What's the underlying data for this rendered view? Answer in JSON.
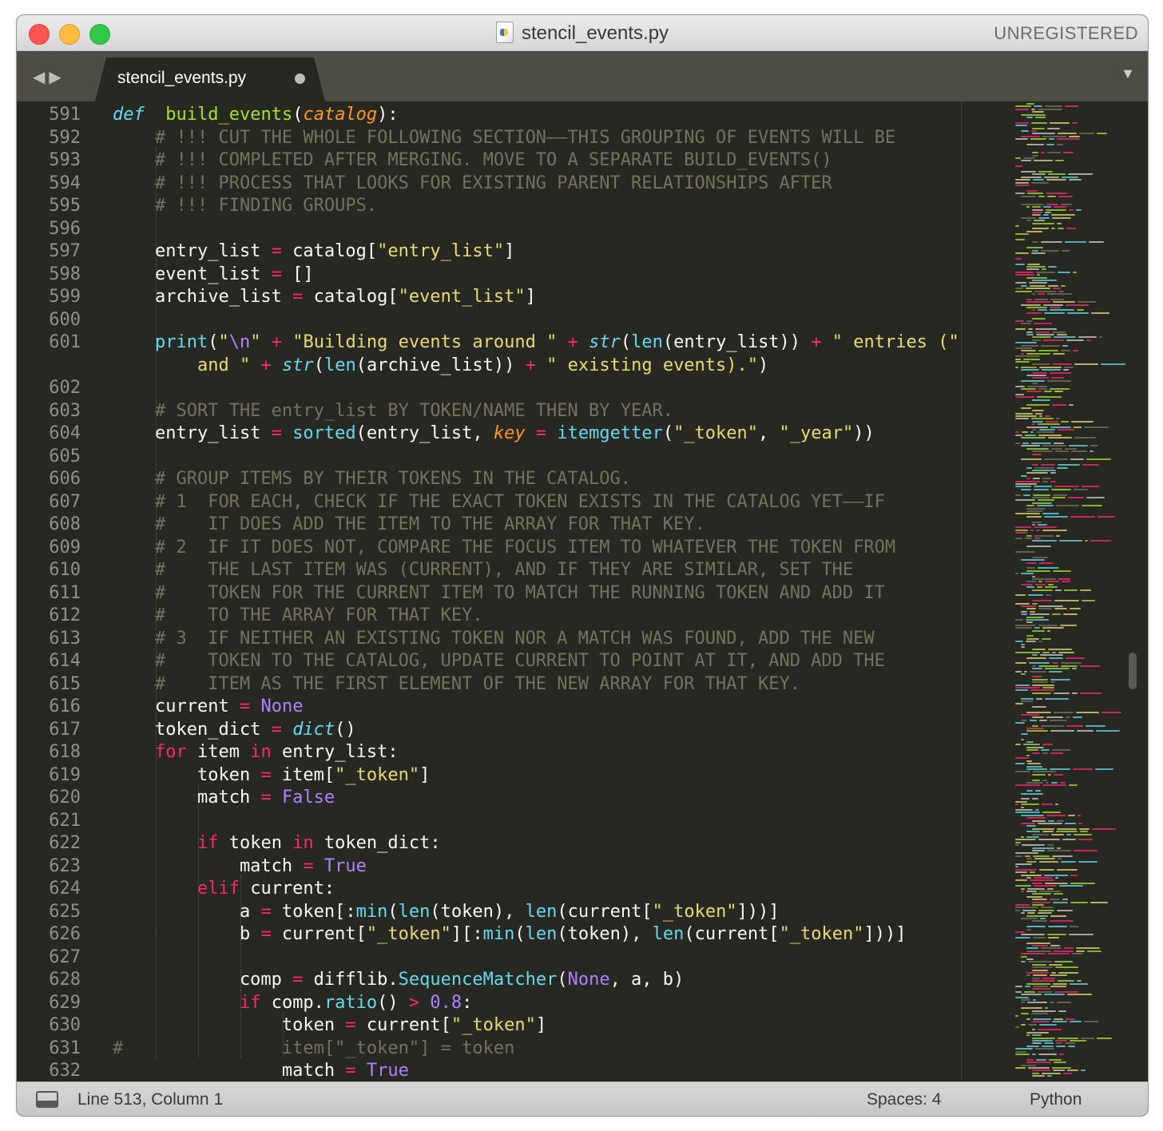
{
  "window": {
    "title": "stencil_events.py",
    "registration_label": "UNREGISTERED"
  },
  "tabbar": {
    "active_tab": "stencil_events.py"
  },
  "editor": {
    "lines": [
      {
        "no": "591",
        "tokens": [
          [
            "df",
            "def"
          ],
          [
            "",
            "  "
          ],
          [
            "fn",
            "build_events"
          ],
          [
            "",
            "("
          ],
          [
            "pr",
            "catalog"
          ],
          [
            "",
            "):"
          ]
        ]
      },
      {
        "no": "592",
        "tokens": [
          [
            "",
            "    "
          ],
          [
            "cm",
            "# !!! CUT THE WHOLE FOLLOWING SECTION——THIS GROUPING OF EVENTS WILL BE"
          ]
        ]
      },
      {
        "no": "593",
        "tokens": [
          [
            "",
            "    "
          ],
          [
            "cm",
            "# !!! COMPLETED AFTER MERGING. MOVE TO A SEPARATE BUILD_EVENTS()"
          ]
        ]
      },
      {
        "no": "594",
        "tokens": [
          [
            "",
            "    "
          ],
          [
            "cm",
            "# !!! PROCESS THAT LOOKS FOR EXISTING PARENT RELATIONSHIPS AFTER"
          ]
        ]
      },
      {
        "no": "595",
        "tokens": [
          [
            "",
            "    "
          ],
          [
            "cm",
            "# !!! FINDING GROUPS."
          ]
        ]
      },
      {
        "no": "596",
        "tokens": []
      },
      {
        "no": "597",
        "tokens": [
          [
            "",
            "    entry_list "
          ],
          [
            "kw",
            "="
          ],
          [
            "",
            " catalog["
          ],
          [
            "st",
            "\"entry_list\""
          ],
          [
            "",
            "]"
          ]
        ]
      },
      {
        "no": "598",
        "tokens": [
          [
            "",
            "    event_list "
          ],
          [
            "kw",
            "="
          ],
          [
            "",
            " []"
          ]
        ]
      },
      {
        "no": "599",
        "tokens": [
          [
            "",
            "    archive_list "
          ],
          [
            "kw",
            "="
          ],
          [
            "",
            " catalog["
          ],
          [
            "st",
            "\"event_list\""
          ],
          [
            "",
            "]"
          ]
        ]
      },
      {
        "no": "600",
        "tokens": []
      },
      {
        "no": "601",
        "tokens": [
          [
            "",
            "    "
          ],
          [
            "bi",
            "print"
          ],
          [
            "",
            "("
          ],
          [
            "st",
            "\""
          ],
          [
            "nu",
            "\\n"
          ],
          [
            "st",
            "\""
          ],
          [
            "",
            " "
          ],
          [
            "kw",
            "+"
          ],
          [
            "",
            " "
          ],
          [
            "st",
            "\"Building events around \""
          ],
          [
            "",
            " "
          ],
          [
            "kw",
            "+"
          ],
          [
            "",
            " "
          ],
          [
            "it",
            "str"
          ],
          [
            "",
            "("
          ],
          [
            "bi",
            "len"
          ],
          [
            "",
            "(entry_list)) "
          ],
          [
            "kw",
            "+"
          ],
          [
            "",
            " "
          ],
          [
            "st",
            "\" entries (\""
          ]
        ]
      },
      {
        "no": "",
        "tokens": [
          [
            "",
            "        "
          ],
          [
            "st",
            "and \""
          ],
          [
            "",
            " "
          ],
          [
            "kw",
            "+"
          ],
          [
            "",
            " "
          ],
          [
            "it",
            "str"
          ],
          [
            "",
            "("
          ],
          [
            "bi",
            "len"
          ],
          [
            "",
            "(archive_list)) "
          ],
          [
            "kw",
            "+"
          ],
          [
            "",
            " "
          ],
          [
            "st",
            "\" existing events).\""
          ],
          [
            "",
            ")"
          ]
        ]
      },
      {
        "no": "602",
        "tokens": []
      },
      {
        "no": "603",
        "tokens": [
          [
            "",
            "    "
          ],
          [
            "cm",
            "# SORT THE entry_list BY TOKEN/NAME THEN BY YEAR."
          ]
        ]
      },
      {
        "no": "604",
        "tokens": [
          [
            "",
            "    entry_list "
          ],
          [
            "kw",
            "="
          ],
          [
            "",
            " "
          ],
          [
            "bi",
            "sorted"
          ],
          [
            "",
            "(entry_list, "
          ],
          [
            "pr",
            "key"
          ],
          [
            "",
            " "
          ],
          [
            "kw",
            "="
          ],
          [
            "",
            " "
          ],
          [
            "bi",
            "itemgetter"
          ],
          [
            "",
            "("
          ],
          [
            "st",
            "\"_token\""
          ],
          [
            "",
            ", "
          ],
          [
            "st",
            "\"_year\""
          ],
          [
            "",
            "))"
          ]
        ]
      },
      {
        "no": "605",
        "tokens": []
      },
      {
        "no": "606",
        "tokens": [
          [
            "",
            "    "
          ],
          [
            "cm",
            "# GROUP ITEMS BY THEIR TOKENS IN THE CATALOG."
          ]
        ]
      },
      {
        "no": "607",
        "tokens": [
          [
            "",
            "    "
          ],
          [
            "cm",
            "# 1  FOR EACH, CHECK IF THE EXACT TOKEN EXISTS IN THE CATALOG YET——IF"
          ]
        ]
      },
      {
        "no": "608",
        "tokens": [
          [
            "",
            "    "
          ],
          [
            "cm",
            "#    IT DOES ADD THE ITEM TO THE ARRAY FOR THAT KEY."
          ]
        ]
      },
      {
        "no": "609",
        "tokens": [
          [
            "",
            "    "
          ],
          [
            "cm",
            "# 2  IF IT DOES NOT, COMPARE THE FOCUS ITEM TO WHATEVER THE TOKEN FROM"
          ]
        ]
      },
      {
        "no": "610",
        "tokens": [
          [
            "",
            "    "
          ],
          [
            "cm",
            "#    THE LAST ITEM WAS (CURRENT), AND IF THEY ARE SIMILAR, SET THE"
          ]
        ]
      },
      {
        "no": "611",
        "tokens": [
          [
            "",
            "    "
          ],
          [
            "cm",
            "#    TOKEN FOR THE CURRENT ITEM TO MATCH THE RUNNING TOKEN AND ADD IT"
          ]
        ]
      },
      {
        "no": "612",
        "tokens": [
          [
            "",
            "    "
          ],
          [
            "cm",
            "#    TO THE ARRAY FOR THAT KEY."
          ]
        ]
      },
      {
        "no": "613",
        "tokens": [
          [
            "",
            "    "
          ],
          [
            "cm",
            "# 3  IF NEITHER AN EXISTING TOKEN NOR A MATCH WAS FOUND, ADD THE NEW"
          ]
        ]
      },
      {
        "no": "614",
        "tokens": [
          [
            "",
            "    "
          ],
          [
            "cm",
            "#    TOKEN TO THE CATALOG, UPDATE CURRENT TO POINT AT IT, AND ADD THE"
          ]
        ]
      },
      {
        "no": "615",
        "tokens": [
          [
            "",
            "    "
          ],
          [
            "cm",
            "#    ITEM AS THE FIRST ELEMENT OF THE NEW ARRAY FOR THAT KEY."
          ]
        ]
      },
      {
        "no": "616",
        "tokens": [
          [
            "",
            "    current "
          ],
          [
            "kw",
            "="
          ],
          [
            "",
            " "
          ],
          [
            "nu",
            "None"
          ]
        ]
      },
      {
        "no": "617",
        "tokens": [
          [
            "",
            "    token_dict "
          ],
          [
            "kw",
            "="
          ],
          [
            "",
            " "
          ],
          [
            "it",
            "dict"
          ],
          [
            "",
            "()"
          ]
        ]
      },
      {
        "no": "618",
        "tokens": [
          [
            "",
            "    "
          ],
          [
            "kw",
            "for"
          ],
          [
            "",
            " item "
          ],
          [
            "kw",
            "in"
          ],
          [
            "",
            " entry_list:"
          ]
        ]
      },
      {
        "no": "619",
        "tokens": [
          [
            "",
            "        token "
          ],
          [
            "kw",
            "="
          ],
          [
            "",
            " item["
          ],
          [
            "st",
            "\"_token\""
          ],
          [
            "",
            "]"
          ]
        ]
      },
      {
        "no": "620",
        "tokens": [
          [
            "",
            "        match "
          ],
          [
            "kw",
            "="
          ],
          [
            "",
            " "
          ],
          [
            "nu",
            "False"
          ]
        ]
      },
      {
        "no": "621",
        "tokens": []
      },
      {
        "no": "622",
        "tokens": [
          [
            "",
            "        "
          ],
          [
            "kw",
            "if"
          ],
          [
            "",
            " token "
          ],
          [
            "kw",
            "in"
          ],
          [
            "",
            " token_dict:"
          ]
        ]
      },
      {
        "no": "623",
        "tokens": [
          [
            "",
            "            match "
          ],
          [
            "kw",
            "="
          ],
          [
            "",
            " "
          ],
          [
            "nu",
            "True"
          ]
        ]
      },
      {
        "no": "624",
        "tokens": [
          [
            "",
            "        "
          ],
          [
            "kw",
            "elif"
          ],
          [
            "",
            " current:"
          ]
        ]
      },
      {
        "no": "625",
        "tokens": [
          [
            "",
            "            a "
          ],
          [
            "kw",
            "="
          ],
          [
            "",
            " token[:"
          ],
          [
            "bi",
            "min"
          ],
          [
            "",
            "("
          ],
          [
            "bi",
            "len"
          ],
          [
            "",
            "(token), "
          ],
          [
            "bi",
            "len"
          ],
          [
            "",
            "(current["
          ],
          [
            "st",
            "\"_token\""
          ],
          [
            "",
            "]))]"
          ]
        ]
      },
      {
        "no": "626",
        "tokens": [
          [
            "",
            "            b "
          ],
          [
            "kw",
            "="
          ],
          [
            "",
            " current["
          ],
          [
            "st",
            "\"_token\""
          ],
          [
            "",
            "][:"
          ],
          [
            "bi",
            "min"
          ],
          [
            "",
            "("
          ],
          [
            "bi",
            "len"
          ],
          [
            "",
            "(token), "
          ],
          [
            "bi",
            "len"
          ],
          [
            "",
            "(current["
          ],
          [
            "st",
            "\"_token\""
          ],
          [
            "",
            "]))]"
          ]
        ]
      },
      {
        "no": "627",
        "tokens": []
      },
      {
        "no": "628",
        "tokens": [
          [
            "",
            "            comp "
          ],
          [
            "kw",
            "="
          ],
          [
            "",
            " difflib."
          ],
          [
            "bi",
            "SequenceMatcher"
          ],
          [
            "",
            "("
          ],
          [
            "nu",
            "None"
          ],
          [
            "",
            ", a, b)"
          ]
        ]
      },
      {
        "no": "629",
        "tokens": [
          [
            "",
            "            "
          ],
          [
            "kw",
            "if"
          ],
          [
            "",
            " comp."
          ],
          [
            "bi",
            "ratio"
          ],
          [
            "",
            "() "
          ],
          [
            "kw",
            ">"
          ],
          [
            "",
            " "
          ],
          [
            "nu",
            "0.8"
          ],
          [
            "",
            ":"
          ]
        ]
      },
      {
        "no": "630",
        "tokens": [
          [
            "",
            "                token "
          ],
          [
            "kw",
            "="
          ],
          [
            "",
            " current["
          ],
          [
            "st",
            "\"_token\""
          ],
          [
            "",
            "]"
          ]
        ]
      },
      {
        "no": "631",
        "tokens": [
          [
            "cm",
            "#               item[\"_token\"] = token"
          ]
        ]
      },
      {
        "no": "632",
        "tokens": [
          [
            "",
            "                match "
          ],
          [
            "kw",
            "="
          ],
          [
            "",
            " "
          ],
          [
            "nu",
            "True"
          ]
        ]
      }
    ]
  },
  "statusbar": {
    "position": "Line 513, Column 1",
    "indentation": "Spaces: 4",
    "syntax": "Python"
  },
  "icons": {
    "file_tab": "file-icon",
    "panel_toggle": "panel-icon"
  },
  "colors": {
    "background": "#272822",
    "comment": "#75715e",
    "keyword": "#f92672",
    "function": "#a6e22e",
    "string": "#e6db74",
    "number": "#ae81ff",
    "builtin": "#66d9ef",
    "parameter": "#fd971f"
  }
}
